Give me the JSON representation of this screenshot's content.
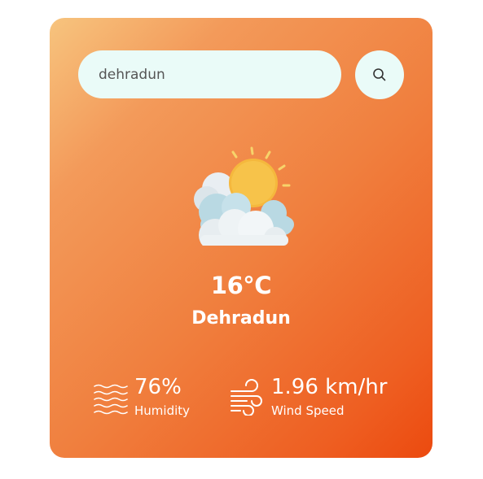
{
  "search": {
    "value": "dehradun",
    "icon": "search-icon"
  },
  "weather": {
    "icon": "partly-cloudy-sun-icon",
    "temperature": "16°C",
    "city": "Dehradun"
  },
  "details": {
    "humidity": {
      "icon": "humidity-waves-icon",
      "value": "76%",
      "label": "Humidity"
    },
    "wind": {
      "icon": "wind-icon",
      "value": "1.96 km/hr",
      "label": "Wind Speed"
    }
  },
  "colors": {
    "card_gradient_start": "#f7c47e",
    "card_gradient_end": "#ec4a0f",
    "input_background": "#eafbf8",
    "text": "#ffffff"
  }
}
